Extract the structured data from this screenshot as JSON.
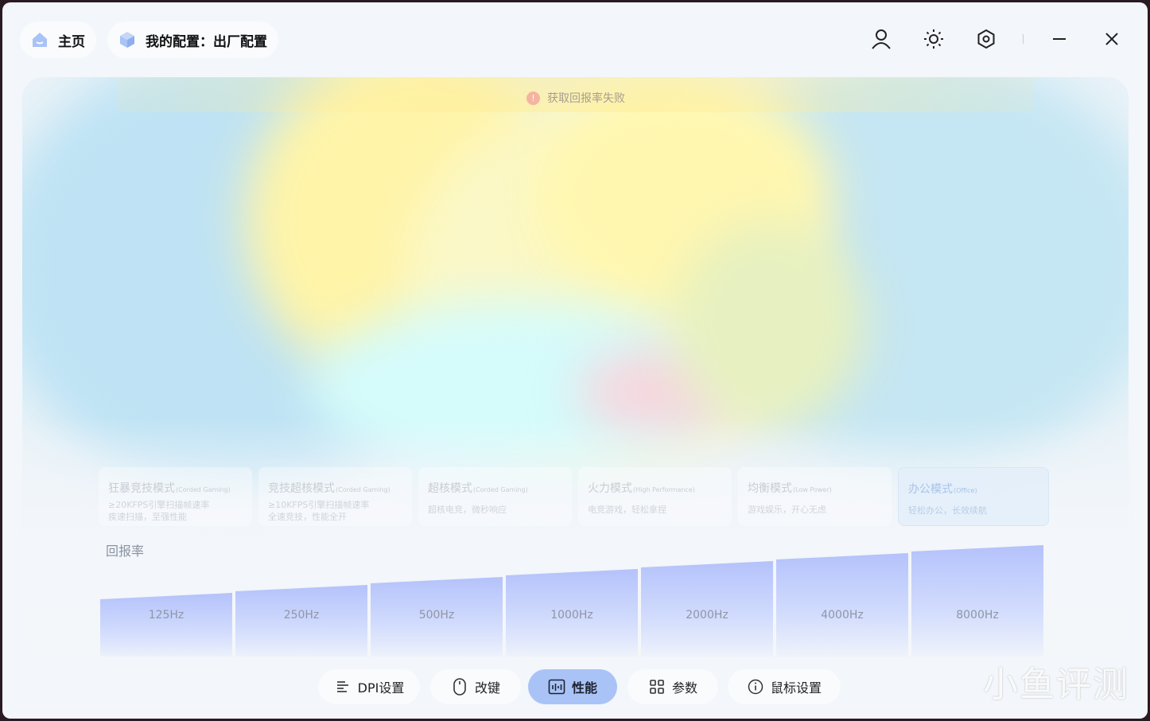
{
  "nav": {
    "home_label": "主页",
    "config_label": "我的配置：出厂配置"
  },
  "titlebar_icons": [
    "user-icon",
    "brightness-icon",
    "settings-icon",
    "minimize-icon",
    "close-icon"
  ],
  "toast": {
    "icon": "!",
    "text": "获取回报率失败"
  },
  "modes": [
    {
      "name": "狂暴竞技模式",
      "tag": "(Corded Gaming)",
      "line1": "≥20KFPS引擎扫描帧速率",
      "line2": "疾速扫描，至强性能",
      "active": false
    },
    {
      "name": "竞技超核模式",
      "tag": "(Corded Gaming)",
      "line1": "≥10KFPS引擎扫描帧速率",
      "line2": "全速竞技，性能全开",
      "active": false
    },
    {
      "name": "超核模式",
      "tag": "(Corded Gaming)",
      "line1": "超核电竞，微秒响应",
      "line2": "",
      "active": false
    },
    {
      "name": "火力模式",
      "tag": "(High Performance)",
      "line1": "电竞游戏，轻松拿捏",
      "line2": "",
      "active": false
    },
    {
      "name": "均衡模式",
      "tag": "(Low Power)",
      "line1": "游戏娱乐，开心无虑",
      "line2": "",
      "active": false
    },
    {
      "name": "办公模式",
      "tag": "(Office)",
      "line1": "轻松办公，长效续航",
      "line2": "",
      "active": true
    }
  ],
  "rate_section": {
    "label": "回报率",
    "rates": [
      "125Hz",
      "250Hz",
      "500Hz",
      "1000Hz",
      "2000Hz",
      "4000Hz",
      "8000Hz"
    ]
  },
  "tabs": [
    {
      "label": "DPI设置",
      "icon": "dpi-icon",
      "active": false
    },
    {
      "label": "改键",
      "icon": "mouse-icon",
      "active": false
    },
    {
      "label": "性能",
      "icon": "performance-icon",
      "active": true
    },
    {
      "label": "参数",
      "icon": "grid-icon",
      "active": false
    },
    {
      "label": "鼠标设置",
      "icon": "info-icon",
      "active": false
    }
  ],
  "watermark": "小鱼评测",
  "colors": {
    "accent": "#a9c3f7",
    "bar": "#b4c2fb",
    "active_mode_text": "#a6c4ea"
  }
}
